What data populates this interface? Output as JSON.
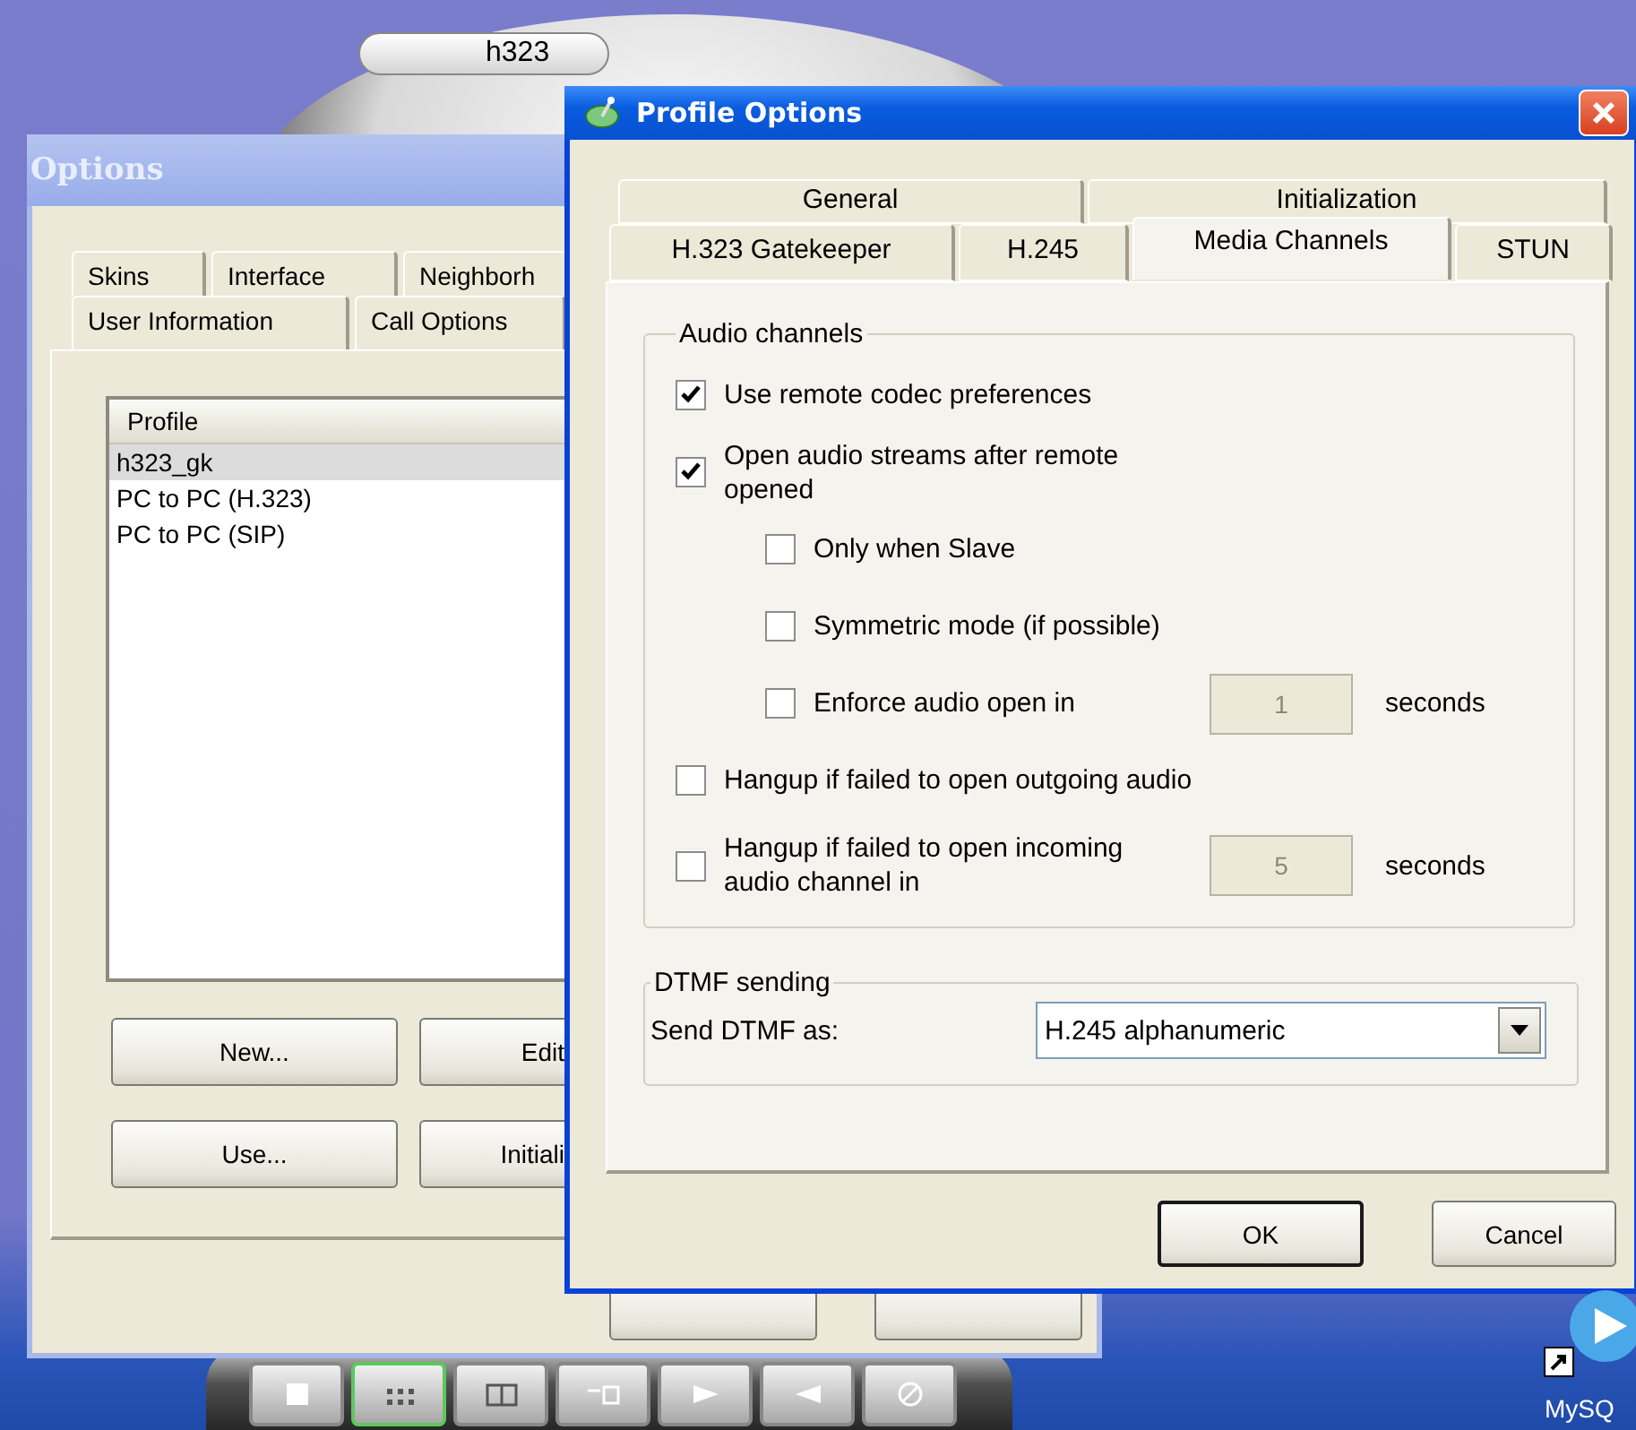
{
  "phone": {
    "display": "h323",
    "toolbar": [
      {
        "kind": "square",
        "selected": false
      },
      {
        "kind": "keypad",
        "selected": true
      },
      {
        "kind": "panel",
        "selected": false
      },
      {
        "kind": "windows",
        "selected": false
      },
      {
        "kind": "forward",
        "selected": false
      },
      {
        "kind": "back",
        "selected": false
      },
      {
        "kind": "blocked",
        "selected": false
      }
    ]
  },
  "options_window": {
    "title": "Options",
    "tabs": [
      [
        "Skins",
        "Interface",
        "Neighborh"
      ],
      [
        "User Information",
        "Call Options"
      ]
    ],
    "profile_list": {
      "header": "Profile",
      "items": [
        {
          "label": "h323_gk",
          "selected": true
        },
        {
          "label": "PC to PC (H.323)",
          "selected": false
        },
        {
          "label": "PC to PC (SIP)",
          "selected": false
        }
      ]
    },
    "buttons": [
      [
        "New...",
        "Edit"
      ],
      [
        "Use...",
        "Initiali"
      ]
    ]
  },
  "profile_window": {
    "title": "Profile Options",
    "tabs": [
      [
        {
          "label": "General",
          "selected": false
        },
        {
          "label": "Initialization",
          "selected": false
        }
      ],
      [
        {
          "label": "H.323 Gatekeeper",
          "selected": false
        },
        {
          "label": "H.245",
          "selected": false
        },
        {
          "label": "Media Channels",
          "selected": true
        },
        {
          "label": "STUN",
          "selected": false
        }
      ]
    ],
    "audio_group": {
      "title": "Audio channels",
      "options": [
        {
          "kind": "check",
          "label": "Use remote codec preferences",
          "checked": true,
          "indented": false
        },
        {
          "kind": "check",
          "label": "Open audio streams after remote opened",
          "checked": true,
          "indented": false
        },
        {
          "kind": "check",
          "label": "Only when Slave",
          "checked": false,
          "indented": true
        },
        {
          "kind": "check",
          "label": "Symmetric mode (if possible)",
          "checked": false,
          "indented": true
        },
        {
          "kind": "seconds",
          "label": "Enforce audio open in",
          "checked": false,
          "indented": true,
          "value": "1",
          "unit": "seconds",
          "disabled": true
        },
        {
          "kind": "check",
          "label": "Hangup if failed to open outgoing audio",
          "checked": false,
          "indented": false
        },
        {
          "kind": "seconds",
          "label": "Hangup if failed to open incoming audio channel in",
          "checked": false,
          "indented": false,
          "value": "5",
          "unit": "seconds",
          "disabled": true
        }
      ]
    },
    "dtmf_group": {
      "title": "DTMF sending",
      "label": "Send DTMF as:",
      "value": "H.245 alphanumeric"
    },
    "buttons": [
      {
        "label": "OK",
        "default": true
      },
      {
        "label": "Cancel",
        "default": false
      }
    ]
  },
  "desktop_icon": {
    "label": "MySQ"
  }
}
